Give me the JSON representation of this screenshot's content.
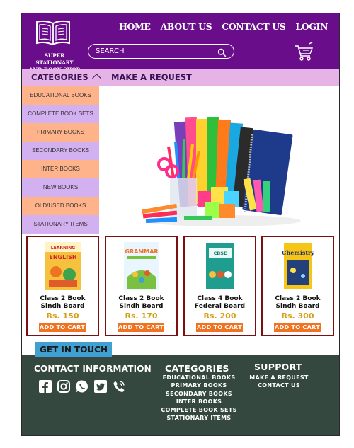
{
  "brand": {
    "name_line1": "SUPER STATIONARY",
    "name_line2": "AND BOOK SHOP",
    "logo_icon": "open-book-icon"
  },
  "nav": {
    "items": [
      "HOME",
      "ABOUT US",
      "CONTACT US",
      "LOGIN"
    ]
  },
  "search": {
    "placeholder": "SEARCH",
    "icon": "search-icon"
  },
  "cart": {
    "icon": "shopping-cart-icon"
  },
  "subnav": {
    "categories_label": "CATEGORIES",
    "request_label": "MAKE A REQUEST"
  },
  "dropdown": {
    "items": [
      "EDUCATIONAL BOOKS",
      "COMPLETE BOOK SETS",
      "PRIMARY BOOKS",
      "SECONDARY BOOKS",
      "INTER BOOKS",
      "NEW BOOKS",
      "OLD/USED BOOKS",
      "STATIONARY ITEMS"
    ]
  },
  "products": [
    {
      "title_line1": "Class 2 Book",
      "title_line2": "Sindh Board",
      "price": "Rs. 150",
      "cart_label": "ADD TO CART",
      "cover_text": "ENGLISH"
    },
    {
      "title_line1": "Class 2 Book",
      "title_line2": "Sindh Board",
      "price": "Rs. 170",
      "cart_label": "ADD TO CART",
      "cover_text": "GRAMMAR"
    },
    {
      "title_line1": "Class 4 Book",
      "title_line2": "Federal Board",
      "price": "Rs. 200",
      "cart_label": "ADD TO CART",
      "cover_text": "CBSE"
    },
    {
      "title_line1": "Class 2 Book",
      "title_line2": "Sindh Board",
      "price": "Rs. 300",
      "cart_label": "ADD TO CART",
      "cover_text": "Chemistry"
    }
  ],
  "get_in_touch": "GET IN TOUCH",
  "footer": {
    "contact_heading": "CONTACT INFORMATION",
    "socials": [
      "facebook-icon",
      "instagram-icon",
      "whatsapp-icon",
      "twitter-icon",
      "phone-icon"
    ],
    "categories_heading": "CATEGORIES",
    "categories": [
      "EDUCATIONAL BOOKS",
      "PRIMARY BOOKS",
      "SECONDARY BOOKS",
      "INTER BOOKS",
      "COMPLETE BOOK SETS",
      "STATIONARY ITEMS"
    ],
    "support_heading": "SUPPORT",
    "support": [
      "MAKE A REQUEST",
      "CONTACT US"
    ]
  },
  "colors": {
    "header": "#6a0d8a",
    "subnav": "#e6b3e6",
    "dd_orange": "#ffb38a",
    "dd_purple": "#d3b0ef",
    "price": "#d4a017",
    "cart_button": "#f07322",
    "footer": "#35483f",
    "card_border": "#7a1010"
  }
}
